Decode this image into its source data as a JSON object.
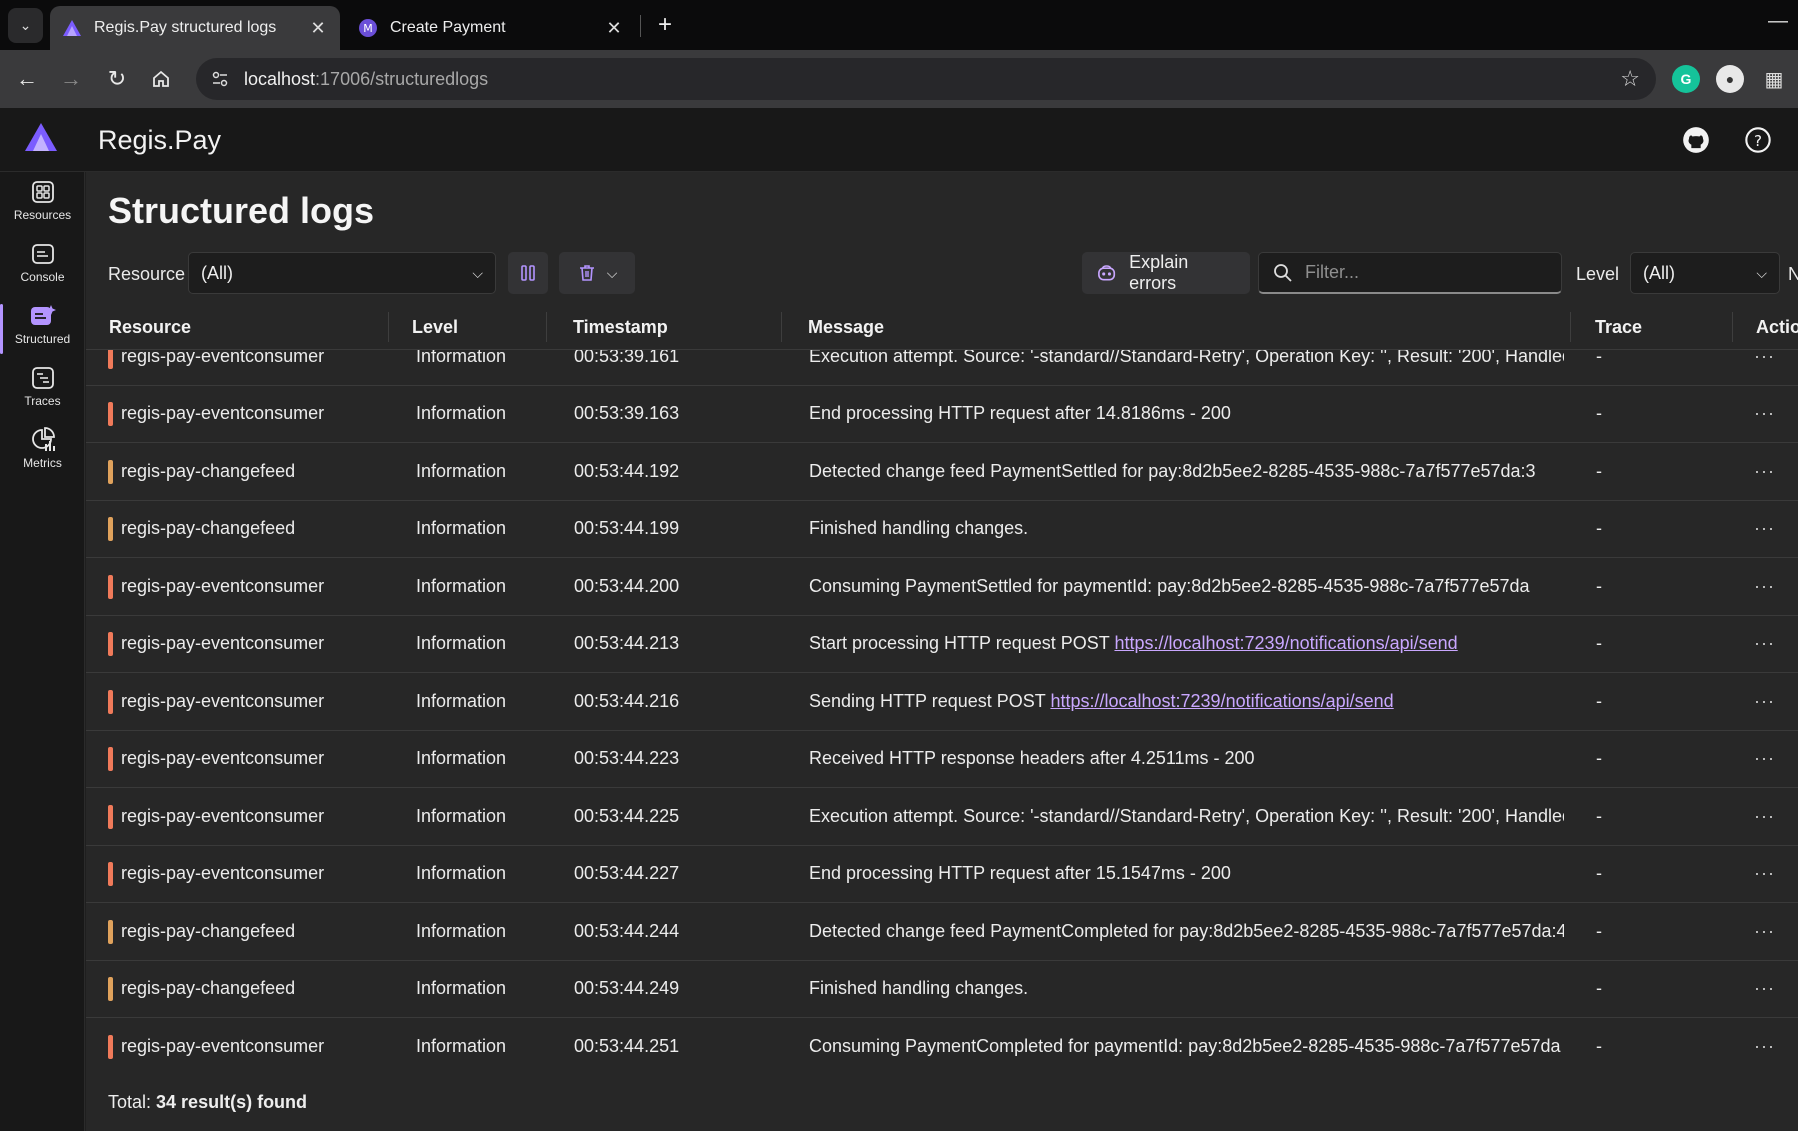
{
  "browser": {
    "tabs": [
      {
        "title": "Regis.Pay structured logs",
        "active": true
      },
      {
        "title": "Create Payment",
        "active": false
      }
    ],
    "url_host": "localhost",
    "url_path": ":17006/structuredlogs"
  },
  "app": {
    "title": "Regis.Pay",
    "accent": "#b394ff"
  },
  "sidebar": {
    "items": [
      {
        "label": "Resources",
        "icon": "resources-icon"
      },
      {
        "label": "Console",
        "icon": "console-icon"
      },
      {
        "label": "Structured",
        "icon": "structured-icon",
        "active": true
      },
      {
        "label": "Traces",
        "icon": "traces-icon"
      },
      {
        "label": "Metrics",
        "icon": "metrics-icon"
      }
    ]
  },
  "page": {
    "title": "Structured logs",
    "filters": {
      "resource_label": "Resource",
      "resource_value": "(All)",
      "explain_label": "Explain errors",
      "filter_placeholder": "Filter...",
      "level_label": "Level",
      "level_value": "(All)",
      "cutoff_label": "N"
    },
    "columns": {
      "resource": "Resource",
      "level": "Level",
      "timestamp": "Timestamp",
      "message": "Message",
      "trace": "Trace",
      "actions": "Actio"
    },
    "rows": [
      {
        "resource": "regis-pay-eventconsumer",
        "color": "#f07a5a",
        "level": "Information",
        "timestamp": "00:53:39.161",
        "message": "Execution attempt. Source: '-standard//Standard-Retry', Operation Key: '', Result: '200', Handled: ...",
        "trace": "-",
        "actions": "···"
      },
      {
        "resource": "regis-pay-eventconsumer",
        "color": "#f07a5a",
        "level": "Information",
        "timestamp": "00:53:39.163",
        "message": "End processing HTTP request after 14.8186ms - 200",
        "trace": "-",
        "actions": "···"
      },
      {
        "resource": "regis-pay-changefeed",
        "color": "#e0a25c",
        "level": "Information",
        "timestamp": "00:53:44.192",
        "message": "Detected change feed PaymentSettled for pay:8d2b5ee2-8285-4535-988c-7a7f577e57da:3",
        "trace": "-",
        "actions": "···"
      },
      {
        "resource": "regis-pay-changefeed",
        "color": "#e0a25c",
        "level": "Information",
        "timestamp": "00:53:44.199",
        "message": "Finished handling changes.",
        "trace": "-",
        "actions": "···"
      },
      {
        "resource": "regis-pay-eventconsumer",
        "color": "#f07a5a",
        "level": "Information",
        "timestamp": "00:53:44.200",
        "message": "Consuming PaymentSettled for paymentId: pay:8d2b5ee2-8285-4535-988c-7a7f577e57da",
        "trace": "-",
        "actions": "···"
      },
      {
        "resource": "regis-pay-eventconsumer",
        "color": "#f07a5a",
        "level": "Information",
        "timestamp": "00:53:44.213",
        "message": "Start processing HTTP request POST ",
        "link": "https://localhost:7239/notifications/api/send",
        "trace": "-",
        "actions": "···"
      },
      {
        "resource": "regis-pay-eventconsumer",
        "color": "#f07a5a",
        "level": "Information",
        "timestamp": "00:53:44.216",
        "message": "Sending HTTP request POST ",
        "link": "https://localhost:7239/notifications/api/send",
        "trace": "-",
        "actions": "···"
      },
      {
        "resource": "regis-pay-eventconsumer",
        "color": "#f07a5a",
        "level": "Information",
        "timestamp": "00:53:44.223",
        "message": "Received HTTP response headers after 4.2511ms - 200",
        "trace": "-",
        "actions": "···"
      },
      {
        "resource": "regis-pay-eventconsumer",
        "color": "#f07a5a",
        "level": "Information",
        "timestamp": "00:53:44.225",
        "message": "Execution attempt. Source: '-standard//Standard-Retry', Operation Key: '', Result: '200', Handled: ...",
        "trace": "-",
        "actions": "···"
      },
      {
        "resource": "regis-pay-eventconsumer",
        "color": "#f07a5a",
        "level": "Information",
        "timestamp": "00:53:44.227",
        "message": "End processing HTTP request after 15.1547ms - 200",
        "trace": "-",
        "actions": "···"
      },
      {
        "resource": "regis-pay-changefeed",
        "color": "#e0a25c",
        "level": "Information",
        "timestamp": "00:53:44.244",
        "message": "Detected change feed PaymentCompleted for pay:8d2b5ee2-8285-4535-988c-7a7f577e57da:4",
        "trace": "-",
        "actions": "···"
      },
      {
        "resource": "regis-pay-changefeed",
        "color": "#e0a25c",
        "level": "Information",
        "timestamp": "00:53:44.249",
        "message": "Finished handling changes.",
        "trace": "-",
        "actions": "···"
      },
      {
        "resource": "regis-pay-eventconsumer",
        "color": "#f07a5a",
        "level": "Information",
        "timestamp": "00:53:44.251",
        "message": "Consuming PaymentCompleted for paymentId: pay:8d2b5ee2-8285-4535-988c-7a7f577e57da",
        "trace": "-",
        "actions": "···"
      }
    ],
    "footer": {
      "prefix": "Total: ",
      "count": "34 result(s) found"
    }
  }
}
